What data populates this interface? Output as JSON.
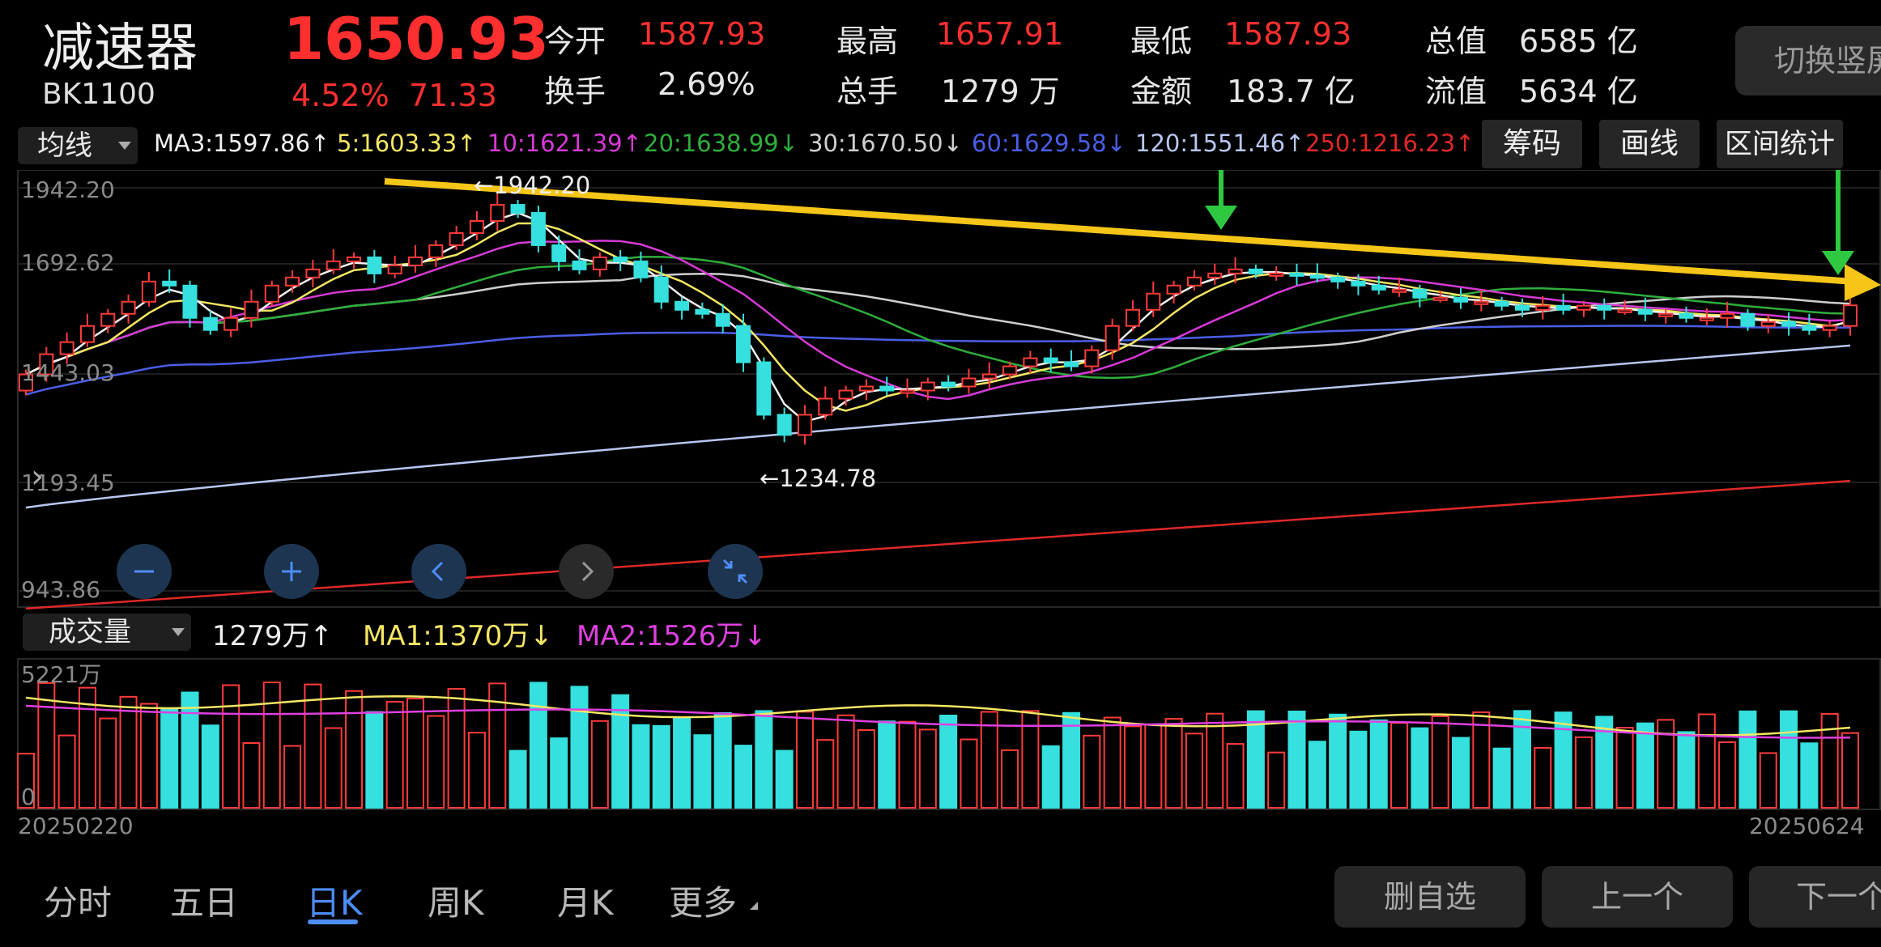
{
  "header": {
    "name": "减速器",
    "code": "BK1100",
    "price": "1650.93",
    "change_pct": "4.52%",
    "change_abs": "71.33",
    "stats": [
      {
        "label": "今开",
        "value": "1587.93",
        "color": "red"
      },
      {
        "label": "换手",
        "value": "2.69%",
        "color": "white"
      },
      {
        "label": "最高",
        "value": "1657.91",
        "color": "red"
      },
      {
        "label": "总手",
        "value": "1279 万",
        "color": "white"
      },
      {
        "label": "最低",
        "value": "1587.93",
        "color": "red"
      },
      {
        "label": "金额",
        "value": "183.7 亿",
        "color": "white"
      },
      {
        "label": "总值",
        "value": "6585 亿",
        "color": "white"
      },
      {
        "label": "流值",
        "value": "5634 亿",
        "color": "white"
      }
    ],
    "switch_button": "切换竖屏"
  },
  "ma_bar": {
    "type_label": "均线",
    "items": [
      {
        "text": "MA3:1597.86↑",
        "color": "#f0f0f0"
      },
      {
        "text": "5:1603.33↑",
        "color": "#f5e663"
      },
      {
        "text": "10:1621.39↑",
        "color": "#d63ad6"
      },
      {
        "text": "20:1638.99↓",
        "color": "#2fae3c"
      },
      {
        "text": "30:1670.50↓",
        "color": "#d0d0d0"
      },
      {
        "text": "60:1629.58↓",
        "color": "#4b5ee6"
      },
      {
        "text": "120:1551.46↑",
        "color": "#b9c6f0"
      },
      {
        "text": "250:1216.23↑",
        "color": "#e02828"
      }
    ],
    "tools": [
      "筹码",
      "画线",
      "区间统计"
    ]
  },
  "kline": {
    "y_labels": [
      "1942.20",
      "1692.62",
      "1443.03",
      "1193.45",
      "943.86"
    ],
    "high_marker": "←1942.20",
    "low_marker": "←1234.78",
    "colors": {
      "up": "#ff3b3b",
      "down": "#35e0de",
      "trend": "#f5c518",
      "arrow": "#2ec940"
    }
  },
  "volume_bar": {
    "type_label": "成交量",
    "vol": "1279万↑",
    "ma1": "MA1:1370万↓",
    "ma2": "MA2:1526万↓",
    "y_top": "5221万",
    "y_zero": "0",
    "date_start": "20250220",
    "date_end": "20250624"
  },
  "bottom_nav": {
    "tabs": [
      "分时",
      "五日",
      "日K",
      "周K",
      "月K",
      "更多"
    ],
    "buttons": [
      "删自选",
      "上一个",
      "下一个"
    ]
  },
  "chart_data": {
    "type": "candlestick",
    "x_range": [
      "20250220",
      "20250624"
    ],
    "ylim": [
      943.86,
      1942.2
    ],
    "period_high": 1942.2,
    "period_low": 1234.78,
    "moving_averages": {
      "MA3": 1597.86,
      "MA5": 1603.33,
      "MA10": 1621.39,
      "MA20": 1638.99,
      "MA30": 1670.5,
      "MA60": 1629.58,
      "MA120": 1551.46,
      "MA250": 1216.23
    },
    "volume": {
      "latest": "1279万",
      "MA1": "1370万",
      "MA2": "1526万",
      "ymax": "5221万"
    },
    "close_series": [
      1480,
      1530,
      1560,
      1600,
      1630,
      1660,
      1710,
      1700,
      1620,
      1590,
      1620,
      1660,
      1700,
      1720,
      1740,
      1760,
      1770,
      1730,
      1750,
      1770,
      1800,
      1830,
      1860,
      1900,
      1880,
      1800,
      1760,
      1740,
      1770,
      1760,
      1720,
      1660,
      1640,
      1630,
      1600,
      1510,
      1380,
      1330,
      1380,
      1420,
      1440,
      1450,
      1440,
      1440,
      1460,
      1450,
      1470,
      1480,
      1500,
      1520,
      1510,
      1500,
      1540,
      1600,
      1640,
      1680,
      1700,
      1720,
      1730,
      1740,
      1730,
      1730,
      1725,
      1720,
      1710,
      1700,
      1690,
      1690,
      1670,
      1670,
      1660,
      1660,
      1650,
      1640,
      1650,
      1640,
      1650,
      1640,
      1640,
      1630,
      1630,
      1620,
      1620,
      1630,
      1600,
      1610,
      1600,
      1590,
      1600,
      1651
    ]
  }
}
